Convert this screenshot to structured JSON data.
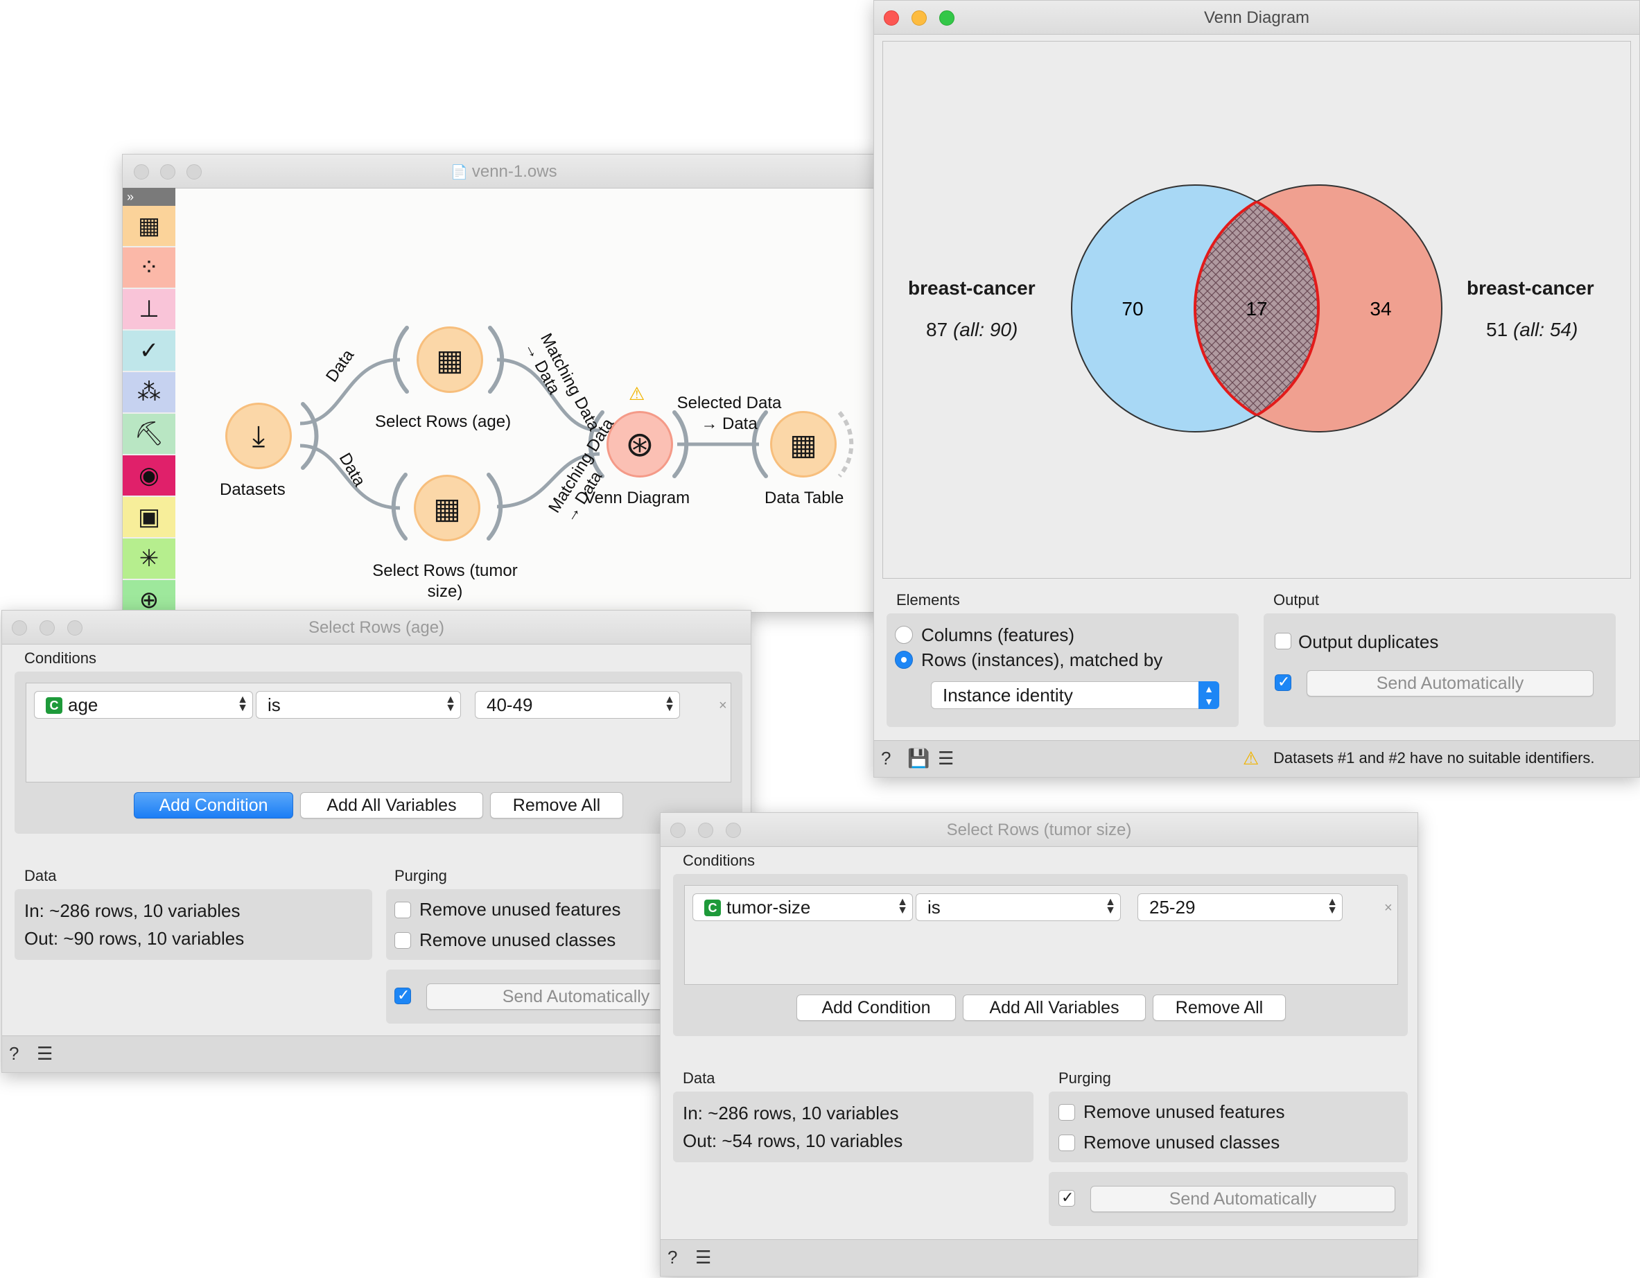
{
  "canvas_window": {
    "title": "venn-1.ows",
    "widgets": {
      "datasets": "Datasets",
      "select_age": "Select Rows (age)",
      "select_tumor": "Select Rows (tumor\nsize)",
      "venn": "Venn Diagram",
      "data_table": "Data Table"
    },
    "links": {
      "data1": "Data",
      "data2": "Data",
      "matching1": "Matching Data\n→ Data",
      "matching2": "Matching Data\n→ Data",
      "selected": "Selected Data\n→ Data"
    },
    "toolbox": [
      "data",
      "visualize",
      "model",
      "evaluate",
      "unsupervised",
      "educational",
      "image-analytics",
      "image",
      "network",
      "geo"
    ]
  },
  "venn_window": {
    "title": "Venn Diagram",
    "chart_data": {
      "type": "venn",
      "sets": [
        {
          "name": "breast-cancer",
          "count_label": "87",
          "all_label": "(all: 90)",
          "color": "#a8d8f5"
        },
        {
          "name": "breast-cancer",
          "count_label": "51",
          "all_label": "(all: 54)",
          "color": "#f0a090"
        }
      ],
      "regions": {
        "left_only": 70,
        "intersection": 17,
        "right_only": 34
      }
    },
    "elements_label": "Elements",
    "columns_label": "Columns (features)",
    "rows_label": "Rows (instances), matched by",
    "match_select": "Instance identity",
    "output_label": "Output",
    "output_duplicates": "Output duplicates",
    "send_auto": "Send Automatically",
    "warning": "Datasets #1 and #2 have no suitable identifiers."
  },
  "age_window": {
    "title": "Select Rows (age)",
    "conditions_label": "Conditions",
    "condition": {
      "badge": "C",
      "variable": "age",
      "operator": "is",
      "value": "40-49"
    },
    "add_condition": "Add Condition",
    "add_all": "Add All Variables",
    "remove_all": "Remove All",
    "data_label": "Data",
    "data_in": "In: ~286 rows, 10 variables",
    "data_out": "Out: ~90 rows, 10 variables",
    "purging_label": "Purging",
    "remove_features": "Remove unused features",
    "remove_classes": "Remove unused classes",
    "send_auto": "Send Automatically"
  },
  "tumor_window": {
    "title": "Select Rows (tumor size)",
    "conditions_label": "Conditions",
    "condition": {
      "badge": "C",
      "variable": "tumor-size",
      "operator": "is",
      "value": "25-29"
    },
    "add_condition": "Add Condition",
    "add_all": "Add All Variables",
    "remove_all": "Remove All",
    "data_label": "Data",
    "data_in": "In: ~286 rows, 10 variables",
    "data_out": "Out: ~54 rows, 10 variables",
    "purging_label": "Purging",
    "remove_features": "Remove unused features",
    "remove_classes": "Remove unused classes",
    "send_auto": "Send Automatically"
  }
}
